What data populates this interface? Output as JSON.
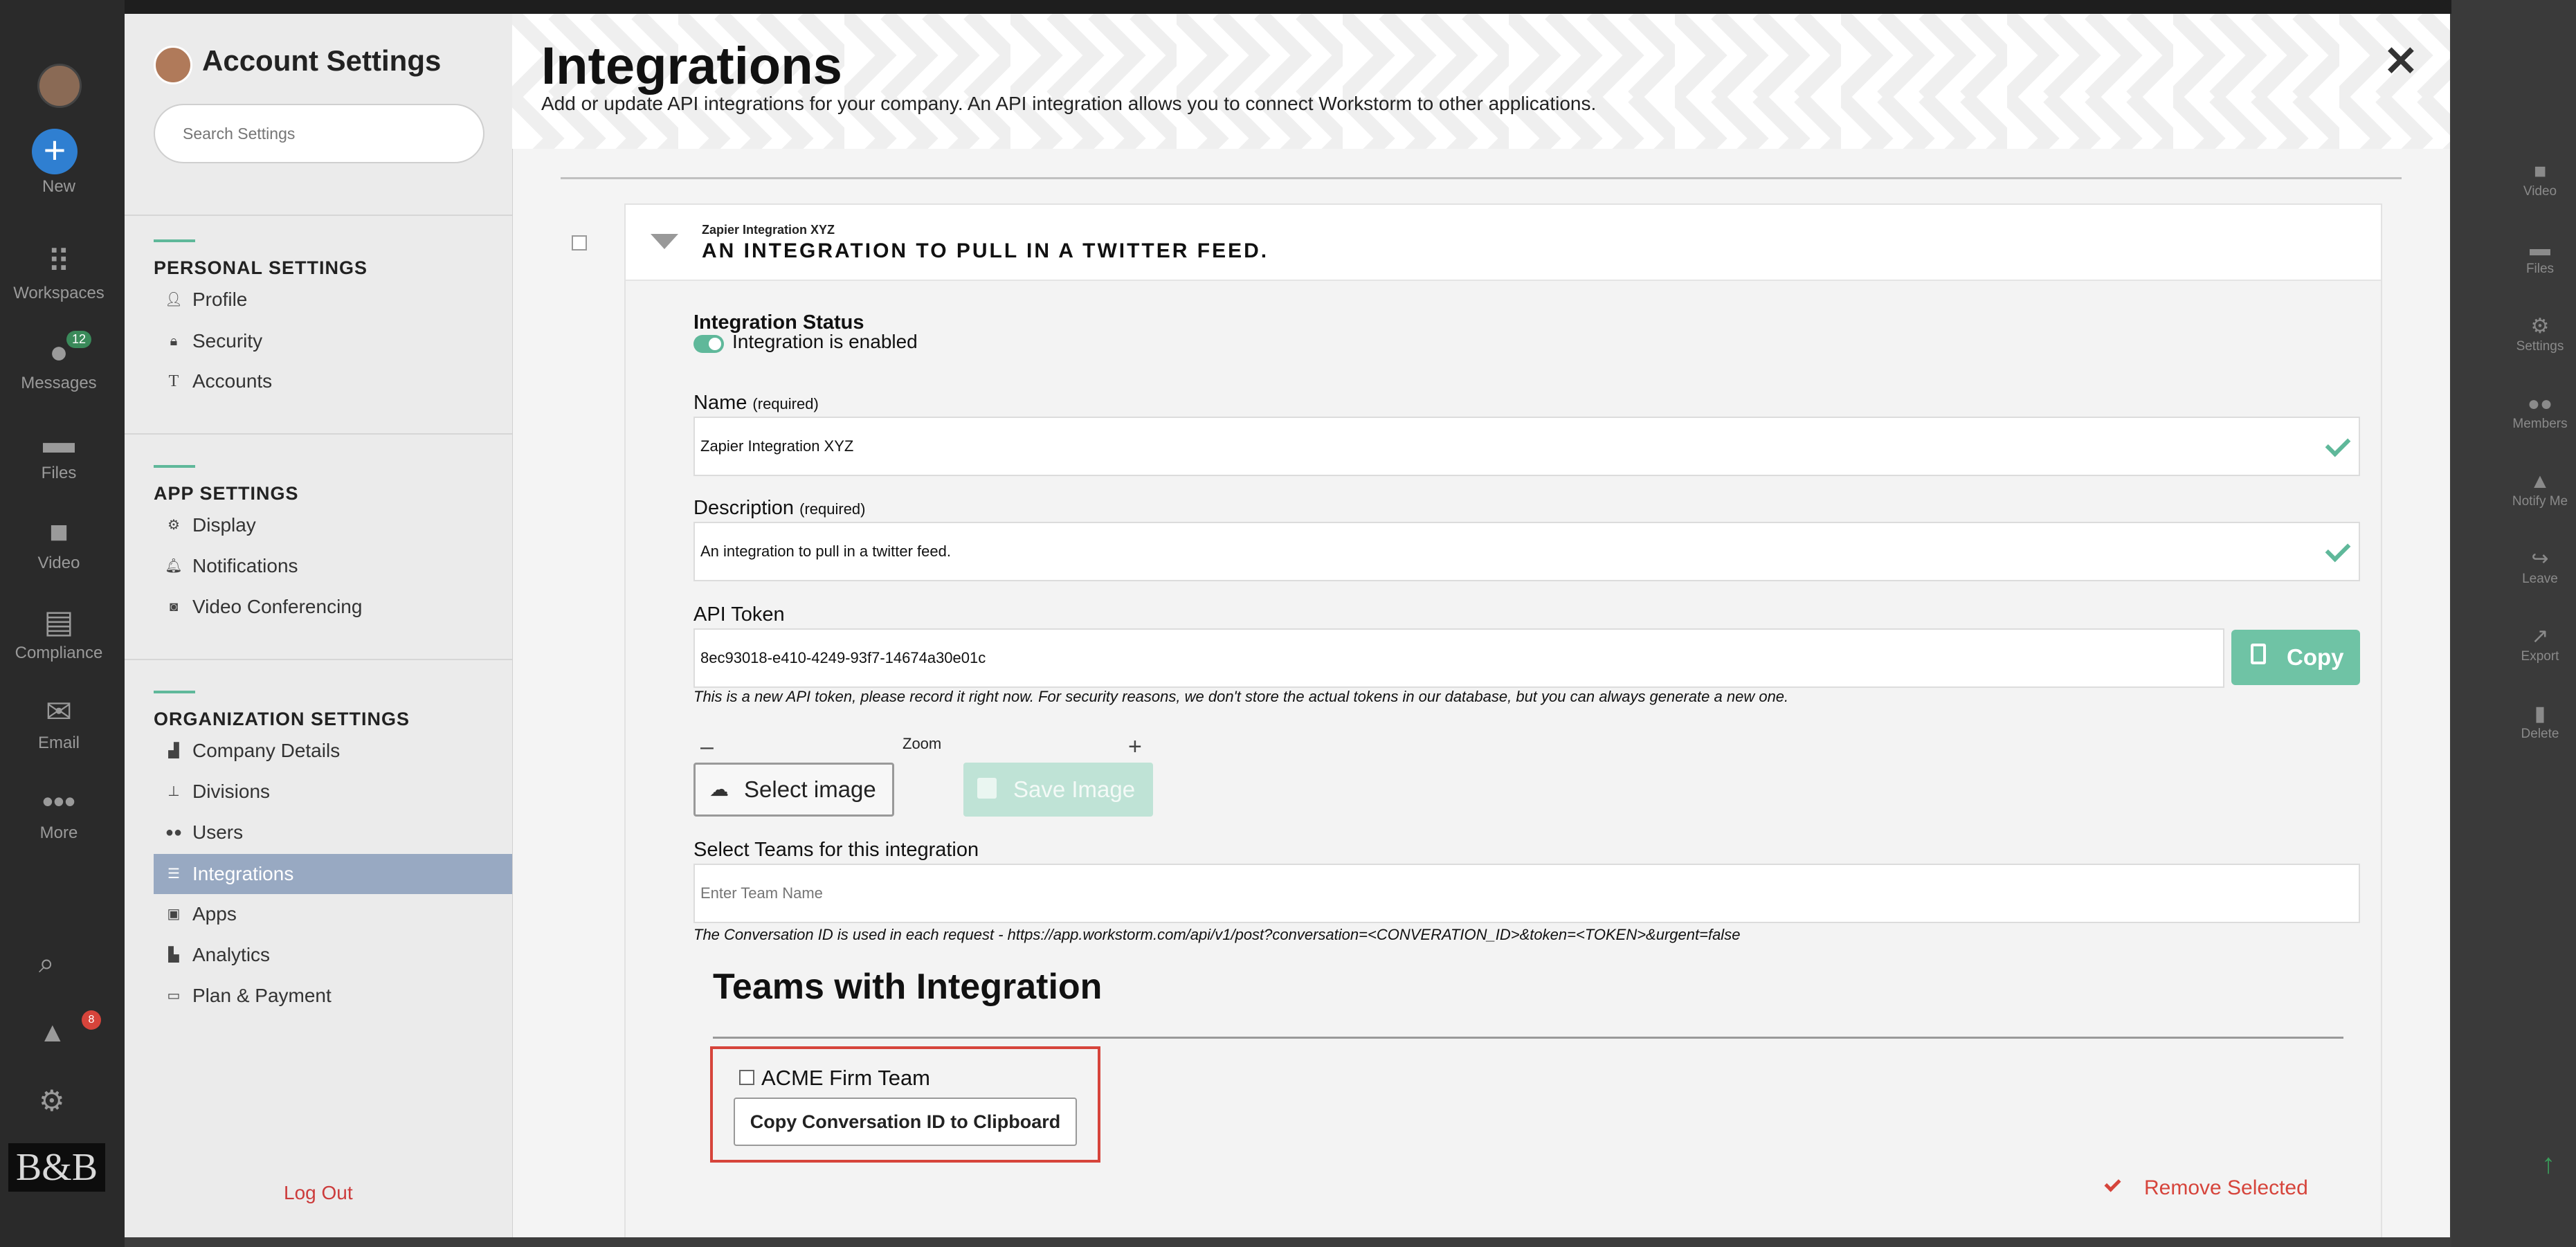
{
  "background_app": {
    "left_rail": [
      {
        "label": "New",
        "icon": "plus-circle-icon"
      },
      {
        "label": "Workspaces",
        "icon": "grid-icon"
      },
      {
        "label": "Messages",
        "icon": "chat-bubble-icon",
        "badge": "12"
      },
      {
        "label": "Files",
        "icon": "folder-icon"
      },
      {
        "label": "Video",
        "icon": "video-camera-icon"
      },
      {
        "label": "Compliance",
        "icon": "list-icon"
      },
      {
        "label": "Email",
        "icon": "envelope-icon"
      },
      {
        "label": "More",
        "icon": "ellipsis-icon"
      }
    ],
    "alert_badge": "8",
    "logo_text": "B&B",
    "right_rail": [
      {
        "label": "Video",
        "icon": "video-camera-icon"
      },
      {
        "label": "Files",
        "icon": "folder-icon"
      },
      {
        "label": "Settings",
        "icon": "gear-icon"
      },
      {
        "label": "Members",
        "icon": "people-icon"
      },
      {
        "label": "Notify Me",
        "icon": "bell-icon"
      },
      {
        "label": "Leave",
        "icon": "leave-icon"
      },
      {
        "label": "Export",
        "icon": "export-icon"
      },
      {
        "label": "Delete",
        "icon": "trash-icon"
      }
    ]
  },
  "sidebar": {
    "title": "Account Settings",
    "search_placeholder": "Search Settings",
    "sections": [
      {
        "heading": "PERSONAL SETTINGS",
        "items": [
          {
            "label": "Profile",
            "icon": "person-icon"
          },
          {
            "label": "Security",
            "icon": "lock-icon"
          },
          {
            "label": "Accounts",
            "icon": "accounts-icon"
          }
        ]
      },
      {
        "heading": "APP SETTINGS",
        "items": [
          {
            "label": "Display",
            "icon": "gear-icon"
          },
          {
            "label": "Notifications",
            "icon": "bell-icon"
          },
          {
            "label": "Video Conferencing",
            "icon": "camera-icon"
          }
        ]
      },
      {
        "heading": "ORGANIZATION SETTINGS",
        "items": [
          {
            "label": "Company Details",
            "icon": "building-icon"
          },
          {
            "label": "Divisions",
            "icon": "hierarchy-icon"
          },
          {
            "label": "Users",
            "icon": "users-icon"
          },
          {
            "label": "Integrations",
            "icon": "sliders-icon",
            "active": true
          },
          {
            "label": "Apps",
            "icon": "app-icon"
          },
          {
            "label": "Analytics",
            "icon": "bar-chart-icon"
          },
          {
            "label": "Plan & Payment",
            "icon": "credit-card-icon"
          }
        ]
      }
    ],
    "logout": "Log Out"
  },
  "header": {
    "title": "Integrations",
    "subtitle": "Add or update API integrations for your company. An API integration allows you to connect Workstorm to other applications."
  },
  "integration": {
    "name_small": "Zapier Integration XYZ",
    "description_upper": "AN INTEGRATION TO PULL IN A TWITTER FEED.",
    "status_label": "Integration Status",
    "status_text": "Integration is enabled",
    "status_enabled": true,
    "name_label": "Name",
    "name_req": "(required)",
    "name_value": "Zapier Integration XYZ",
    "description_label": "Description",
    "description_req": "(required)",
    "description_value": "An integration to pull in a twitter feed.",
    "token_label": "API Token",
    "token_value": "8ec93018-e410-4249-93f7-14674a30e01c",
    "copy_label": "Copy",
    "token_note": "This is a new API token, please record it right now. For security reasons, we don't store the actual tokens in our database, but you can always generate a new one.",
    "zoom_minus": "–",
    "zoom_label": "Zoom",
    "zoom_plus": "+",
    "select_image": "Select image",
    "save_image": "Save Image",
    "teams_label": "Select Teams for this integration",
    "team_placeholder": "Enter Team Name",
    "conversation_note": "The Conversation ID is used in each request - https://app.workstorm.com/api/v1/post?conversation=<CONVERATION_ID>&token=<TOKEN>&urgent=false",
    "teams_heading": "Teams with Integration",
    "teams": [
      {
        "name": "ACME Firm Team",
        "checked": false,
        "copy_button": "Copy Conversation ID to Clipboard"
      }
    ],
    "remove_selected": "Remove Selected"
  },
  "colors": {
    "accent_green": "#5fb89a",
    "active_nav": "#98a9c2",
    "danger_red": "#d6443b"
  }
}
